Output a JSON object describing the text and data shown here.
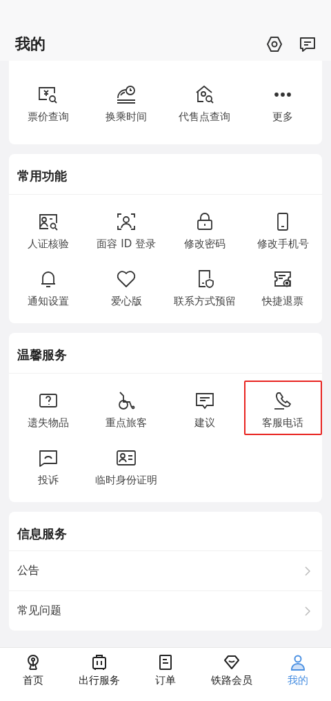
{
  "header": {
    "title": "我的"
  },
  "quick_tools": {
    "items": [
      {
        "label": "票价查询"
      },
      {
        "label": "换乘时间"
      },
      {
        "label": "代售点查询"
      },
      {
        "label": "更多"
      }
    ]
  },
  "sections": [
    {
      "title": "常用功能",
      "items": [
        {
          "label": "人证核验",
          "highlighted": false
        },
        {
          "label": "面容 ID 登录",
          "highlighted": false
        },
        {
          "label": "修改密码",
          "highlighted": false
        },
        {
          "label": "修改手机号",
          "highlighted": false
        },
        {
          "label": "通知设置",
          "highlighted": false
        },
        {
          "label": "爱心版",
          "highlighted": false
        },
        {
          "label": "联系方式预留",
          "highlighted": false
        },
        {
          "label": "快捷退票",
          "highlighted": false
        }
      ]
    },
    {
      "title": "温馨服务",
      "items": [
        {
          "label": "遗失物品",
          "highlighted": false
        },
        {
          "label": "重点旅客",
          "highlighted": false
        },
        {
          "label": "建议",
          "highlighted": false
        },
        {
          "label": "客服电话",
          "highlighted": true
        },
        {
          "label": "投诉",
          "highlighted": false
        },
        {
          "label": "临时身份证明",
          "highlighted": false
        }
      ]
    }
  ],
  "info_services": {
    "title": "信息服务",
    "rows": [
      {
        "label": "公告"
      },
      {
        "label": "常见问题"
      }
    ]
  },
  "tab_bar": [
    {
      "label": "首页",
      "selected": false
    },
    {
      "label": "出行服务",
      "selected": false
    },
    {
      "label": "订单",
      "selected": false
    },
    {
      "label": "铁路会员",
      "selected": false
    },
    {
      "label": "我的",
      "selected": true
    }
  ]
}
